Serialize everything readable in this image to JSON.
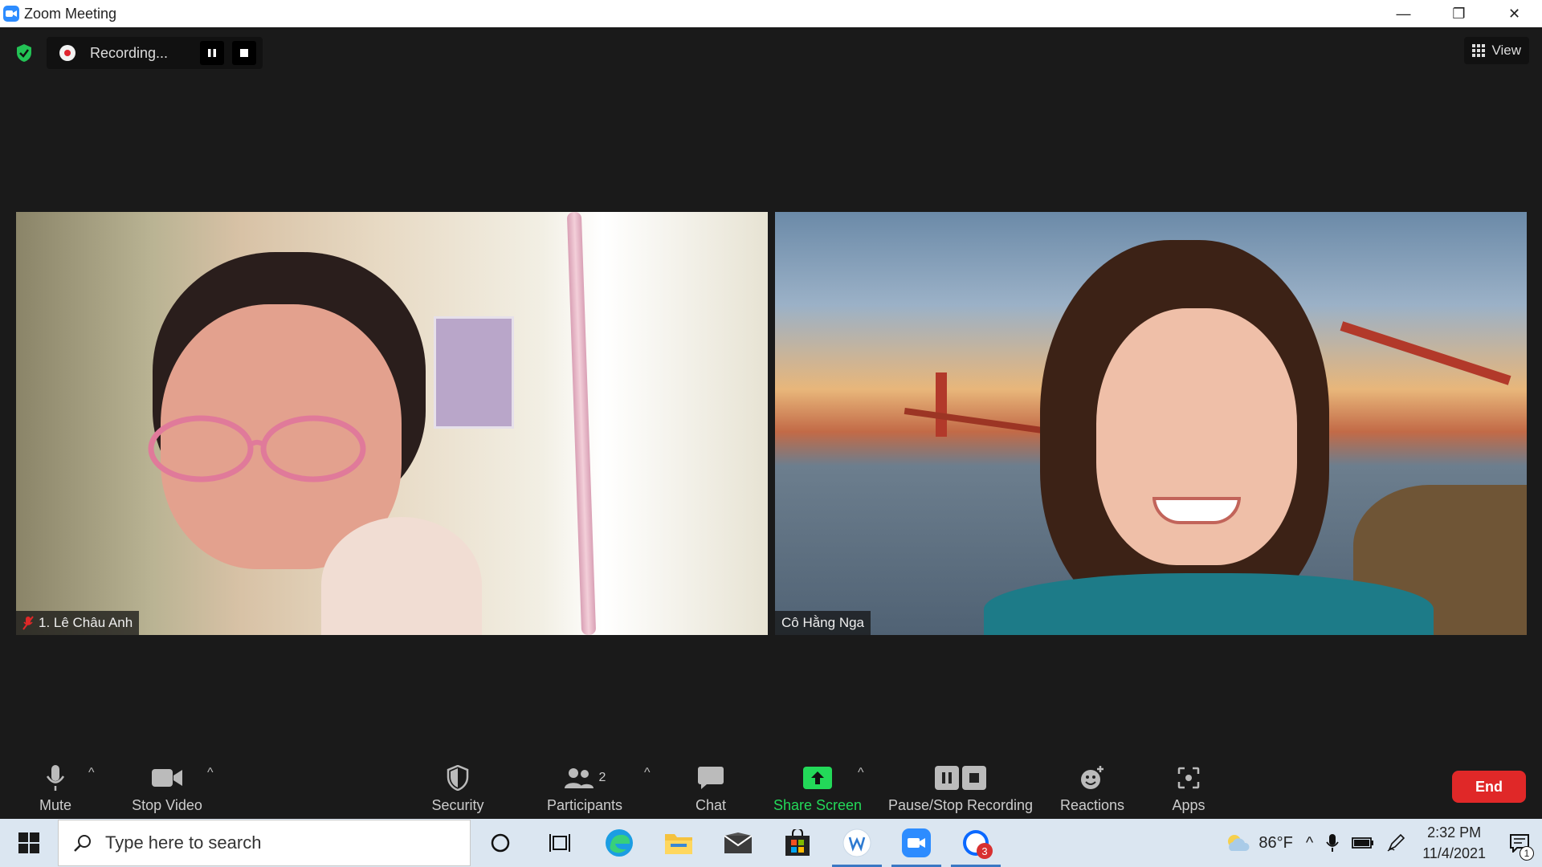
{
  "window": {
    "title": "Zoom Meeting",
    "minimize": "—",
    "restore": "❐",
    "close": "✕"
  },
  "recording": {
    "status": "Recording..."
  },
  "view": {
    "label": "View"
  },
  "participants_video": [
    {
      "name": "1. Lê Châu Anh"
    },
    {
      "name": "Cô Hằng Nga"
    }
  ],
  "toolbar": {
    "mute": "Mute",
    "stop_video": "Stop Video",
    "security": "Security",
    "participants": "Participants",
    "participants_count": "2",
    "chat": "Chat",
    "share_screen": "Share Screen",
    "recording": "Pause/Stop Recording",
    "reactions": "Reactions",
    "apps": "Apps",
    "end": "End"
  },
  "taskbar": {
    "search_placeholder": "Type here to search",
    "weather": "86°F",
    "time": "2:32 PM",
    "date": "11/4/2021",
    "zalo_badge": "3",
    "notification_badge": "1"
  },
  "colors": {
    "accent": "#2d8cff",
    "share_green": "#23d959",
    "end_red": "#e02828",
    "shield_green": "#23c255"
  }
}
